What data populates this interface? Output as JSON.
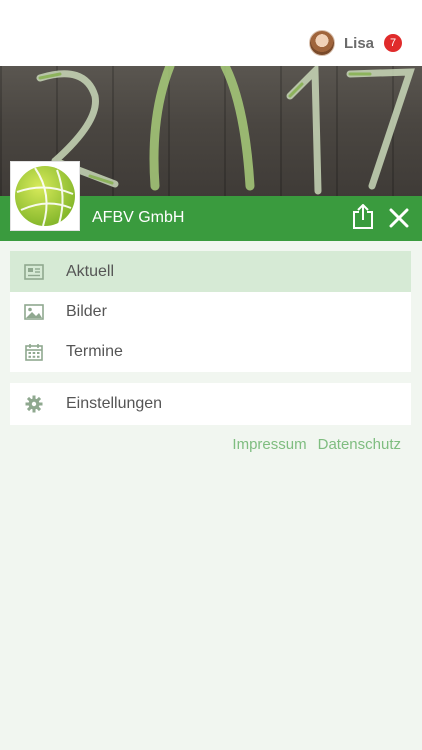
{
  "user": {
    "name": "Lisa",
    "notification_count": "7"
  },
  "header": {
    "company_name": "AFBV GmbH"
  },
  "menu": {
    "items": [
      {
        "label": "Aktuell",
        "icon": "newspaper-icon",
        "active": true
      },
      {
        "label": "Bilder",
        "icon": "image-icon",
        "active": false
      },
      {
        "label": "Termine",
        "icon": "calendar-icon",
        "active": false
      }
    ],
    "settings": {
      "label": "Einstellungen",
      "icon": "gear-icon"
    }
  },
  "footer_links": {
    "impressum": "Impressum",
    "datenschutz": "Datenschutz"
  },
  "colors": {
    "brand_green": "#3a9b3e",
    "active_row": "#d6ead5",
    "link_green": "#7fbd80",
    "badge_red": "#e02b2b",
    "background": "#f1f6f0"
  }
}
